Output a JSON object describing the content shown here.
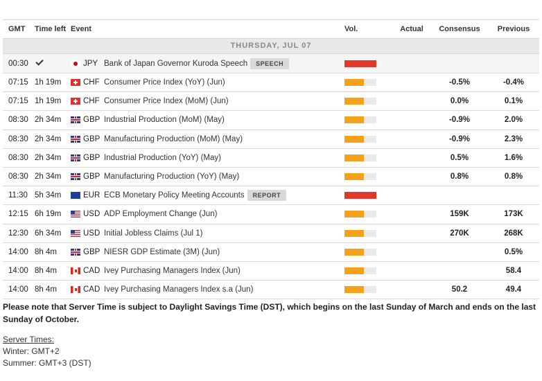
{
  "header": {
    "gmt": "GMT",
    "time_left": "Time left",
    "event": "Event",
    "vol": "Vol.",
    "actual": "Actual",
    "consensus": "Consensus",
    "previous": "Previous"
  },
  "day_label": "THURSDAY, JUL 07",
  "colors": {
    "vol_high": "#e0392b",
    "vol_med": "#f5a21b",
    "vol_track": "#eaeaea"
  },
  "rows": [
    {
      "gmt": "00:30",
      "time_left": "",
      "done": true,
      "flag": "jp",
      "currency": "JPY",
      "event": "Bank of Japan Governor Kuroda Speech",
      "tag": "SPEECH",
      "vol_level": "high",
      "vol_fill": 1.0,
      "actual": "",
      "consensus": "",
      "previous": ""
    },
    {
      "gmt": "07:15",
      "time_left": "1h 19m",
      "flag": "ch",
      "currency": "CHF",
      "event": "Consumer Price Index (YoY) (Jun)",
      "vol_level": "medium",
      "vol_fill": 0.6,
      "actual": "",
      "consensus": "-0.5%",
      "previous": "-0.4%"
    },
    {
      "gmt": "07:15",
      "time_left": "1h 19m",
      "flag": "ch",
      "currency": "CHF",
      "event": "Consumer Price Index (MoM) (Jun)",
      "vol_level": "medium",
      "vol_fill": 0.6,
      "actual": "",
      "consensus": "0.0%",
      "previous": "0.1%"
    },
    {
      "gmt": "08:30",
      "time_left": "2h 34m",
      "flag": "gb",
      "currency": "GBP",
      "event": "Industrial Production (MoM) (May)",
      "vol_level": "medium",
      "vol_fill": 0.6,
      "actual": "",
      "consensus": "-0.9%",
      "previous": "2.0%"
    },
    {
      "gmt": "08:30",
      "time_left": "2h 34m",
      "flag": "gb",
      "currency": "GBP",
      "event": "Manufacturing Production (MoM) (May)",
      "vol_level": "medium",
      "vol_fill": 0.6,
      "actual": "",
      "consensus": "-0.9%",
      "previous": "2.3%"
    },
    {
      "gmt": "08:30",
      "time_left": "2h 34m",
      "flag": "gb",
      "currency": "GBP",
      "event": "Industrial Production (YoY) (May)",
      "vol_level": "medium",
      "vol_fill": 0.6,
      "actual": "",
      "consensus": "0.5%",
      "previous": "1.6%"
    },
    {
      "gmt": "08:30",
      "time_left": "2h 34m",
      "flag": "gb",
      "currency": "GBP",
      "event": "Manufacturing Production (YoY) (May)",
      "vol_level": "medium",
      "vol_fill": 0.6,
      "actual": "",
      "consensus": "0.8%",
      "previous": "0.8%"
    },
    {
      "gmt": "11:30",
      "time_left": "5h 34m",
      "flag": "eu",
      "currency": "EUR",
      "event": "ECB Monetary Policy Meeting Accounts",
      "tag": "REPORT",
      "vol_level": "high",
      "vol_fill": 1.0,
      "actual": "",
      "consensus": "",
      "previous": ""
    },
    {
      "gmt": "12:15",
      "time_left": "6h 19m",
      "flag": "us",
      "currency": "USD",
      "event": "ADP Employment Change (Jun)",
      "vol_level": "medium",
      "vol_fill": 0.6,
      "actual": "",
      "consensus": "159K",
      "previous": "173K"
    },
    {
      "gmt": "12:30",
      "time_left": "6h 34m",
      "flag": "us",
      "currency": "USD",
      "event": "Initial Jobless Claims (Jul 1)",
      "vol_level": "medium",
      "vol_fill": 0.6,
      "actual": "",
      "consensus": "270K",
      "previous": "268K"
    },
    {
      "gmt": "14:00",
      "time_left": "8h 4m",
      "flag": "gb",
      "currency": "GBP",
      "event": "NIESR GDP Estimate (3M) (Jun)",
      "vol_level": "medium",
      "vol_fill": 0.6,
      "actual": "",
      "consensus": "",
      "previous": "0.5%"
    },
    {
      "gmt": "14:00",
      "time_left": "8h 4m",
      "flag": "ca",
      "currency": "CAD",
      "event": "Ivey Purchasing Managers Index (Jun)",
      "vol_level": "medium",
      "vol_fill": 0.6,
      "actual": "",
      "consensus": "",
      "previous": "58.4"
    },
    {
      "gmt": "14:00",
      "time_left": "8h 4m",
      "flag": "ca",
      "currency": "CAD",
      "event": "Ivey Purchasing Managers Index s.a (Jun)",
      "vol_level": "medium",
      "vol_fill": 0.6,
      "actual": "",
      "consensus": "50.2",
      "previous": "49.4"
    }
  ],
  "note": "Please note that Server Time is subject to Daylight Savings Time (DST), which begins on the last Sunday of March and ends on the last Sunday of October.",
  "server_times": {
    "title": "Server Times:",
    "winter": "Winter: GMT+2",
    "summer": "Summer: GMT+3 (DST)"
  }
}
